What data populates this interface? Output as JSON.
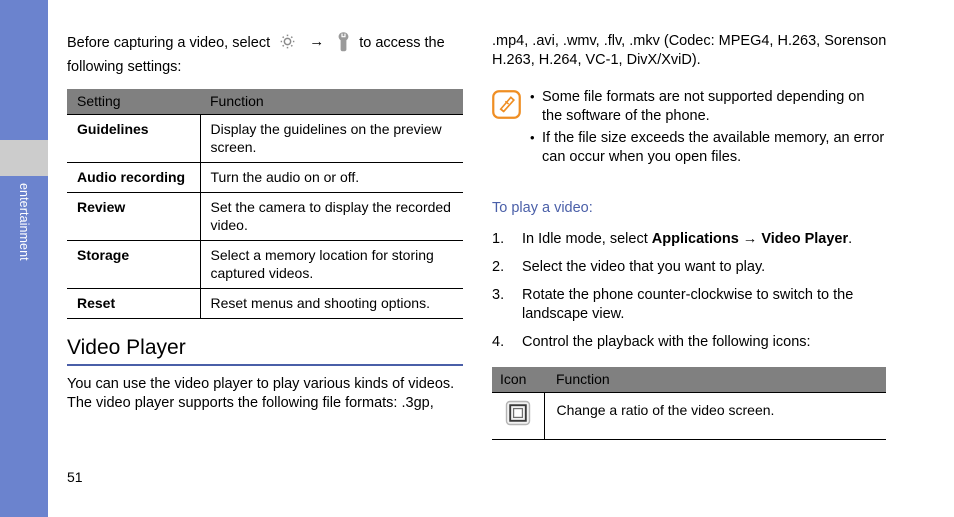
{
  "sidebar": {
    "label": "entertainment",
    "color": "#6b83ce",
    "band_color": "#cccccc"
  },
  "page": {
    "number": "51"
  },
  "left_column": {
    "intro": {
      "text_before": "Before capturing a video, select",
      "gear_icon": "gear-icon",
      "arrow": "→",
      "wrench_icon": "wrench-icon",
      "text_after": "to access the following settings:"
    },
    "settings_table": {
      "headers": [
        "Setting",
        "Function"
      ],
      "rows": [
        {
          "setting": "Guidelines",
          "function": "Display the guidelines on the preview screen."
        },
        {
          "setting": "Audio recording",
          "function": "Turn the audio on or off."
        },
        {
          "setting": "Review",
          "function": "Set the camera to display the recorded video."
        },
        {
          "setting": "Storage",
          "function": "Select a memory location for storing captured videos."
        },
        {
          "setting": "Reset",
          "function": "Reset menus and shooting options."
        }
      ]
    },
    "section_heading": "Video Player",
    "body_text": "You can use the video player to play various kinds of videos. The video player supports the following file formats: .3gp,"
  },
  "right_column": {
    "formats_text": ".mp4, .avi, .wmv, .flv, .mkv (Codec: MPEG4, H.263, Sorenson H.263, H.264, VC-1, DivX/XviD).",
    "note": {
      "icon": "note-pen-icon",
      "bullets": [
        "Some file formats are not supported depending on the software of the phone.",
        "If the file size exceeds the available memory, an error can occur when you open files."
      ]
    },
    "sub_heading": "To play a video:",
    "steps": [
      {
        "num": "1.",
        "parts": [
          {
            "t": "In Idle mode, select ",
            "bold": false
          },
          {
            "t": "Applications",
            "bold": true
          },
          {
            "t": " → ",
            "bold": false
          },
          {
            "t": "Video Player",
            "bold": true
          },
          {
            "t": ".",
            "bold": false
          }
        ]
      },
      {
        "num": "2.",
        "parts": [
          {
            "t": "Select the video that you want to play.",
            "bold": false
          }
        ]
      },
      {
        "num": "3.",
        "parts": [
          {
            "t": "Rotate the phone counter-clockwise to switch to the landscape view.",
            "bold": false
          }
        ]
      },
      {
        "num": "4.",
        "parts": [
          {
            "t": "Control the playback with the following icons:",
            "bold": false
          }
        ]
      }
    ],
    "icon_table": {
      "headers": [
        "Icon",
        "Function"
      ],
      "rows": [
        {
          "icon": "video-ratio-icon",
          "function": "Change a ratio of the video screen."
        }
      ]
    }
  },
  "colors": {
    "accent_blue": "#4a5fa8",
    "sidebar_blue": "#6b83ce",
    "table_header_gray": "#808080",
    "note_orange": "#ef8e23"
  }
}
